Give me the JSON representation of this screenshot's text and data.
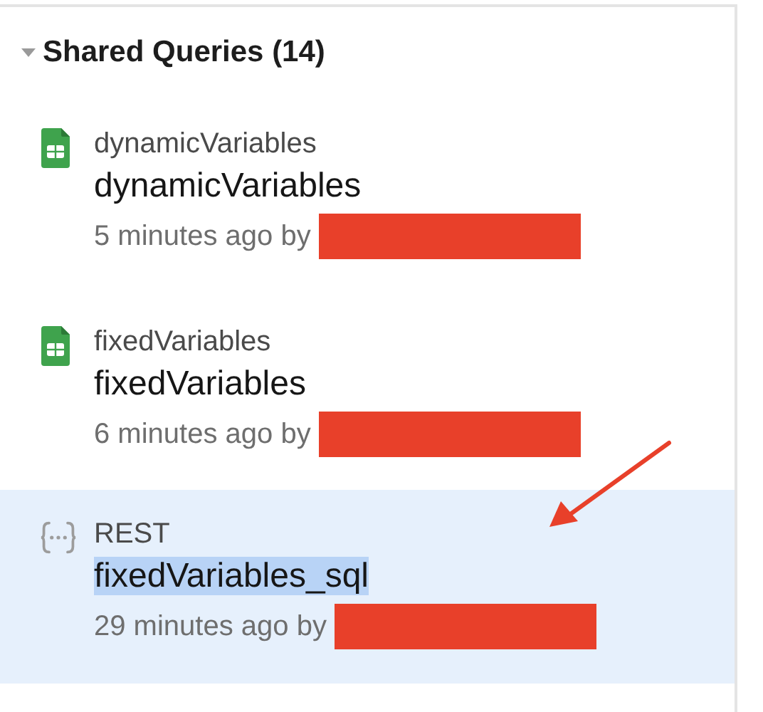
{
  "section": {
    "title": "Shared Queries (14)",
    "expanded": true
  },
  "queries": [
    {
      "kind": "sheet",
      "resource": "dynamicVariables",
      "name": "dynamicVariables",
      "meta": "5 minutes ago by",
      "author_redacted": true,
      "selected": false,
      "name_highlighted": false
    },
    {
      "kind": "sheet",
      "resource": "fixedVariables",
      "name": "fixedVariables",
      "meta": "6 minutes ago by",
      "author_redacted": true,
      "selected": false,
      "name_highlighted": false
    },
    {
      "kind": "rest",
      "resource": "REST",
      "name": "fixedVariables_sql",
      "meta": "29 minutes ago by",
      "author_redacted": true,
      "selected": true,
      "name_highlighted": true
    }
  ],
  "annotation": {
    "kind": "arrow"
  }
}
